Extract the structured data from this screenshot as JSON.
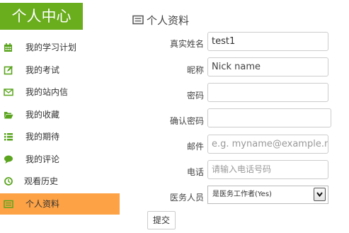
{
  "banner": {
    "title": "个人中心"
  },
  "colors": {
    "banner": "#6aad1d",
    "icon_green": "#5aa41e",
    "active_item": "#fda245"
  },
  "sidebar": {
    "items": [
      {
        "label": "我的学习计划",
        "icon": "calendar-icon"
      },
      {
        "label": "我的考试",
        "icon": "edit-icon"
      },
      {
        "label": "我的站内信",
        "icon": "envelope-icon"
      },
      {
        "label": "我的收藏",
        "icon": "folder-open-icon"
      },
      {
        "label": "我的期待",
        "icon": "list-icon"
      },
      {
        "label": "我的评论",
        "icon": "comment-icon"
      },
      {
        "label": "观看历史",
        "icon": "clock-icon"
      },
      {
        "label": "个人资料",
        "icon": "profile-card-icon",
        "active": true
      }
    ]
  },
  "profile": {
    "section_title": "个人资料",
    "section_icon": "profile-card-icon",
    "real_name": {
      "label": "真实姓名",
      "value": "test1"
    },
    "nickname": {
      "label": "昵称",
      "placeholder": "Nick name"
    },
    "password": {
      "label": "密码",
      "value": ""
    },
    "confirm_password": {
      "label": "确认密码",
      "value": ""
    },
    "email": {
      "label": "邮件",
      "placeholder": "e.g. myname@example.net"
    },
    "phone": {
      "label": "电话",
      "placeholder": "请输入电话号码"
    },
    "medical": {
      "label": "医务人员",
      "selected": "是医务工作者(Yes)"
    },
    "submit_label": "提交"
  }
}
